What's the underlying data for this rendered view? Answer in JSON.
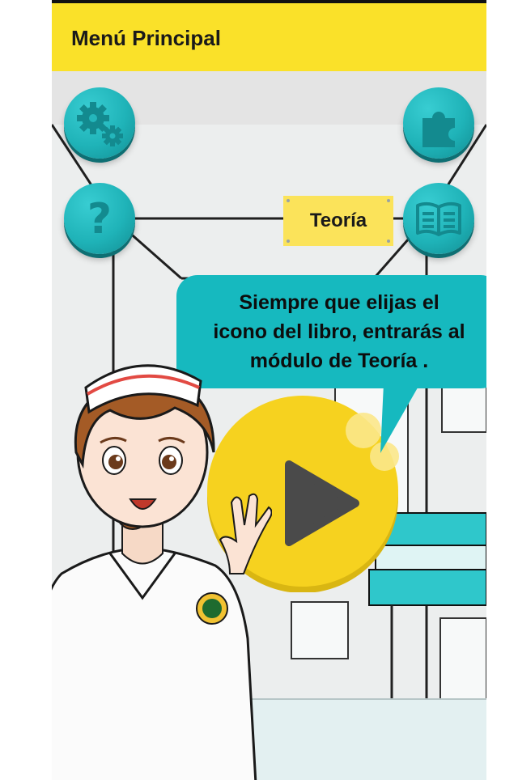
{
  "app_bar": {
    "title": "Menú Principal",
    "background": "#fae129"
  },
  "menu": {
    "settings_icon": "gears-icon",
    "puzzle_icon": "puzzle-piece-icon",
    "help_icon": "question-mark-icon",
    "theory_icon": "book-icon",
    "theory_label": "Teoría",
    "button_color": "#1fb3b8"
  },
  "tutorial": {
    "message": "Siempre que elijas el\nicono del libro, entrarás al\nmódulo de Teoría .",
    "bubble_color": "#16b9bf"
  },
  "play_button": {
    "icon": "play-icon",
    "color": "#f6d21f"
  }
}
